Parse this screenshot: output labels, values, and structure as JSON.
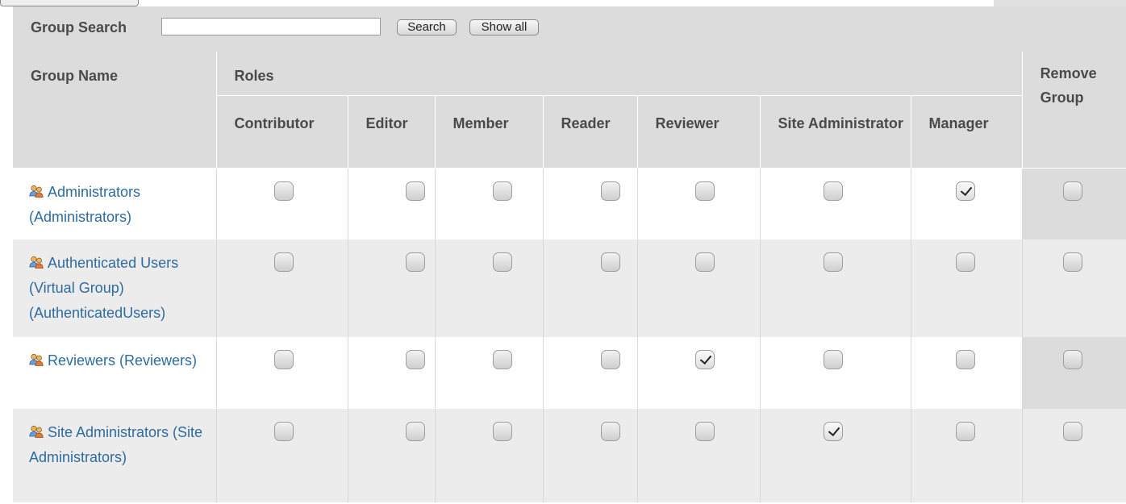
{
  "search": {
    "label": "Group Search",
    "input_value": "",
    "search_button": "Search",
    "show_all_button": "Show all"
  },
  "headers": {
    "group_name": "Group Name",
    "roles": "Roles",
    "remove_group": "Remove Group",
    "role_columns": [
      "Contributor",
      "Editor",
      "Member",
      "Reader",
      "Reviewer",
      "Site Administrator",
      "Manager"
    ]
  },
  "groups": [
    {
      "name": "Administrators (Administrators)",
      "checked": [
        false,
        false,
        false,
        false,
        false,
        false,
        true
      ],
      "remove": false
    },
    {
      "name": "Authenticated Users (Virtual Group) (AuthenticatedUsers)",
      "checked": [
        false,
        false,
        false,
        false,
        false,
        false,
        false
      ],
      "remove": false
    },
    {
      "name": "Reviewers (Reviewers)",
      "checked": [
        false,
        false,
        false,
        false,
        true,
        false,
        false
      ],
      "remove": false
    },
    {
      "name": "Site Administrators (Site Administrators)",
      "checked": [
        false,
        false,
        false,
        false,
        false,
        true,
        false
      ],
      "remove": false
    }
  ],
  "icons": {
    "group": "group-icon"
  }
}
